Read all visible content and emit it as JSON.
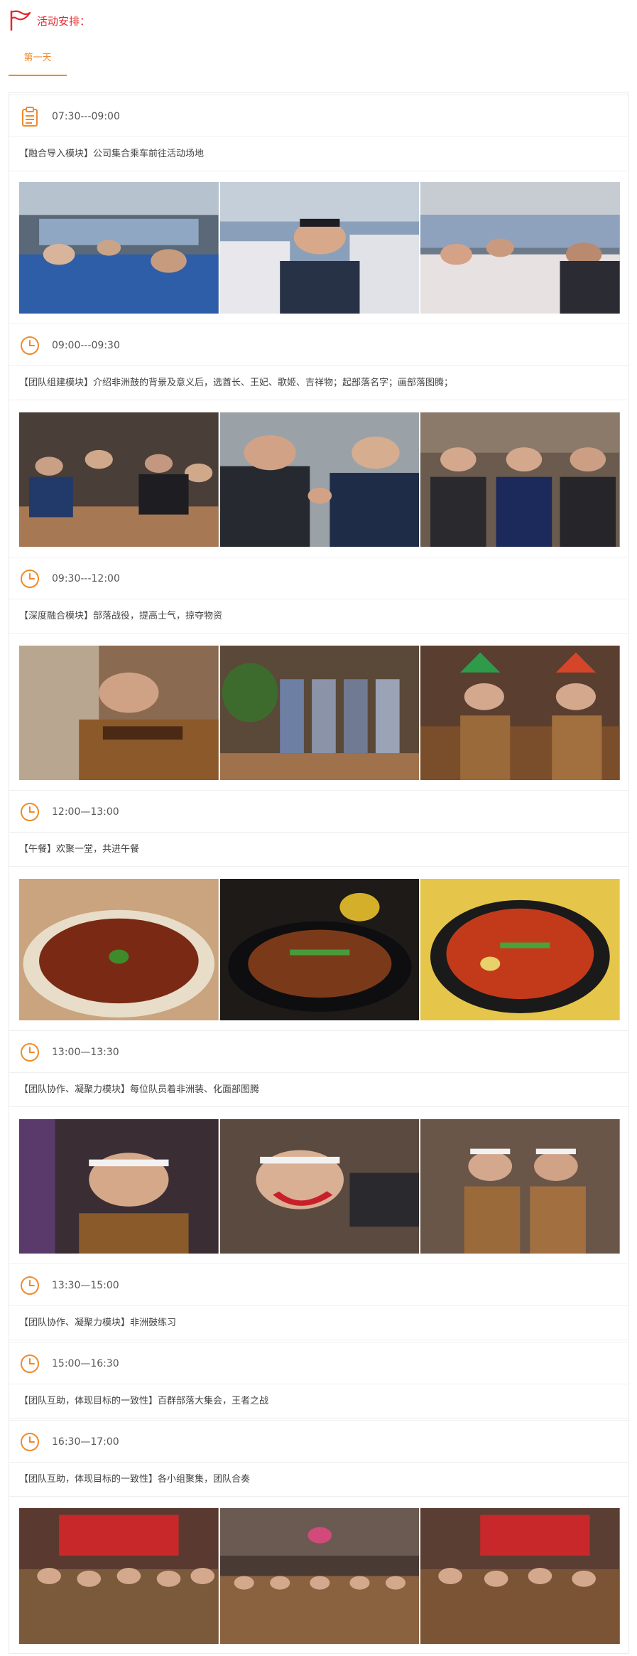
{
  "header": {
    "title": "活动安排：",
    "icon": "flag-icon",
    "accent": "#e8262a"
  },
  "tabs": [
    {
      "label": "第一天",
      "active": true
    }
  ],
  "brand_color": "#f08a2c",
  "schedule": [
    {
      "time": "07:30---09:00",
      "icon": "clipboard-icon",
      "desc": "【融合导入模块】公司集合乘车前往活动场地",
      "photos": [
        "bus-interior-photo",
        "passenger-clapping-photo",
        "bus-group-photo"
      ]
    },
    {
      "time": "09:00---09:30",
      "icon": "clock-icon",
      "desc": "【团队组建模块】介绍非洲鼓的背景及意义后，选酋长、王妃、歌姬、吉祥物；起部落名字；画部落图腾；",
      "photos": [
        "circle-activity-photo",
        "handshake-photo",
        "victory-sign-photo"
      ]
    },
    {
      "time": "09:30---12:00",
      "icon": "clock-icon",
      "desc": "【深度融合模块】部落战役，提高士气，掠夺物资",
      "photos": [
        "tiger-costume-photo",
        "african-drums-photo",
        "feather-headdress-photo"
      ]
    },
    {
      "time": "12:00—13:00",
      "icon": "clock-icon",
      "desc": "【午餐】欢聚一堂，共进午餐",
      "photos": [
        "braised-feet-photo",
        "stir-fry-photo",
        "chicken-pot-photo"
      ]
    },
    {
      "time": "13:00—13:30",
      "icon": "clock-icon",
      "desc": "【团队协作、凝聚力模块】每位队员着非洲装、化面部图腾",
      "photos": [
        "face-paint-photo",
        "painting-face-photo",
        "painted-duo-photo"
      ]
    },
    {
      "time": "13:30—15:00",
      "icon": "clock-icon",
      "desc": "【团队协作、凝聚力模块】非洲鼓练习",
      "photos": []
    },
    {
      "time": "15:00—16:30",
      "icon": "clock-icon",
      "desc": "【团队互助，体现目标的一致性】百群部落大集会，王者之战",
      "photos": []
    },
    {
      "time": "16:30—17:00",
      "icon": "clock-icon",
      "desc": "【团队互助，体现目标的一致性】各小组聚集，团队合奏",
      "photos": [
        "group-drum-photo-1",
        "group-drum-photo-2",
        "group-drum-photo-3"
      ]
    }
  ]
}
